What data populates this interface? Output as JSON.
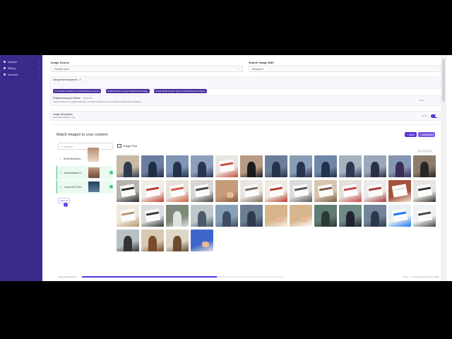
{
  "sidebar": {
    "items": [
      {
        "label": "System",
        "icon": "server-icon"
      },
      {
        "label": "Billing",
        "icon": "card-icon"
      },
      {
        "label": "Account",
        "icon": "user-icon"
      }
    ]
  },
  "form": {
    "image_source_label": "Image Source",
    "image_source_value": "Pexels.com",
    "search_with_label": "Search Image With",
    "search_with_value": "Keyword"
  },
  "keywords_panel": {
    "title": "Using these keywords - 3",
    "tags": [
      "Local SEO Checklist for Small Business Owners",
      "Small Business Content Marketing Strategy",
      "Social Media Growth Tips for Small Business Owners"
    ]
  },
  "postprocess": {
    "title": "Postprocessing & Resize",
    "optional": "Optional",
    "desc": "Learn priority to use global settings, if default settings are off, no postprocessor will be applied.",
    "state": "Show"
  },
  "description": {
    "title": "Image description",
    "sub": "Recommended for now",
    "state": "Show",
    "toggle_color": "#5b34d6"
  },
  "match": {
    "title": "Match images to your content",
    "btn_multi": "Multi",
    "btn_auto": "AutoMatch",
    "search_placeholder": "Search",
    "image_pool": "Image Pool",
    "unused": "Not Yet Assign",
    "clear_all": "Clear All",
    "keywords": [
      {
        "num": "1",
        "label": "Small Business..."
      },
      {
        "num": "2",
        "label": "Social Media G..."
      },
      {
        "num": "3",
        "label": "Local SEO Che..."
      }
    ]
  },
  "progress": {
    "label": "Keywords Matching",
    "percent_text": "67% — 2 of 3 keywords with an image",
    "fraction": 0.67
  },
  "colors": {
    "accent": "#5b34d6",
    "sidebar": "#3b2a8c",
    "success": "#34c77b"
  }
}
